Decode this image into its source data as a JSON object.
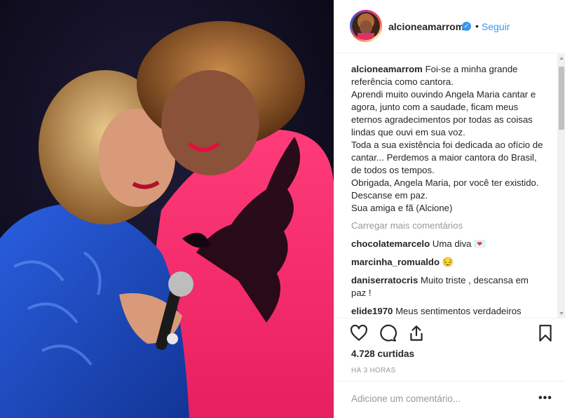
{
  "post": {
    "username": "alcioneamarrom",
    "verified_icon": "verified-badge-icon",
    "separator": "•",
    "follow_label": "Seguir"
  },
  "caption": {
    "username": "alcioneamarrom",
    "lines": [
      "Foi-se a minha grande referência como cantora.",
      "Aprendi muito ouvindo Angela Maria cantar e agora, junto com a saudade, ficam meus eternos agradecimentos por todas as coisas lindas que ouvi em sua voz.",
      "Toda a sua existência foi dedicada ao ofício de cantar... Perdemos a maior cantora do Brasil, de todos os tempos.",
      "Obrigada, Angela Maria, por você ter existido.",
      "Descanse em paz.",
      "Sua amiga e fã (Alcione)"
    ]
  },
  "load_more_label": "Carregar mais comentários",
  "comments": [
    {
      "user": "chocolatemarcelo",
      "text": "Uma diva",
      "emoji": "💌"
    },
    {
      "user": "marcinha_romualdo",
      "text": "",
      "emoji": "😔"
    },
    {
      "user": "daniserratocris",
      "text": "Muito triste , descansa em paz !",
      "emoji": ""
    },
    {
      "user": "elide1970",
      "text": "Meus sentimentos verdadeiros",
      "emoji": ""
    }
  ],
  "actions": {
    "like_icon": "heart-icon",
    "comment_icon": "comment-icon",
    "share_icon": "share-icon",
    "save_icon": "bookmark-icon"
  },
  "likes_text": "4.728 curtidas",
  "timestamp": "HÁ 3 HORAS",
  "add_comment_placeholder": "Adicione um comentário...",
  "more_options": "•••",
  "colors": {
    "link_blue": "#3897f0",
    "muted_gray": "#999999",
    "text_dark": "#262626",
    "dress_pink": "#f0286a",
    "dress_blue": "#1f4fd0"
  }
}
